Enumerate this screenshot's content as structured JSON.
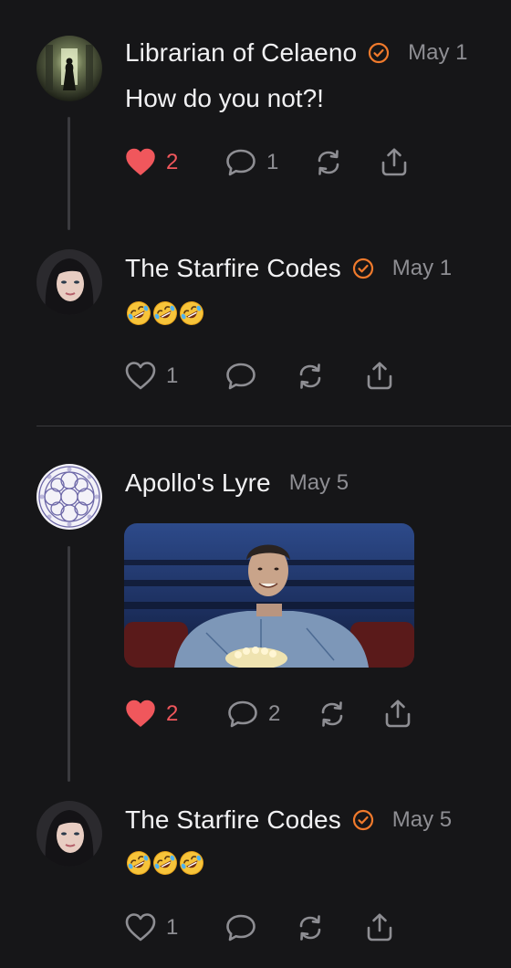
{
  "colors": {
    "background": "#161618",
    "verified": "#f07a2c",
    "liked": "#f0575c",
    "muted": "#8e8e93",
    "text": "#f1f1f3"
  },
  "posts": [
    {
      "author": "Librarian of Celaeno",
      "verified": true,
      "date": "May 1",
      "text": "How do you not?!",
      "liked": true,
      "like_count": "2",
      "reply_count": "1",
      "avatar_icon": "dark-hallway-avatar"
    },
    {
      "author": "The Starfire Codes",
      "verified": true,
      "date": "May 1",
      "emoji": [
        "rolling-on-floor-laughing-emoji",
        "rolling-on-floor-laughing-emoji",
        "rolling-on-floor-laughing-emoji"
      ],
      "liked": false,
      "like_count": "1",
      "reply_count": "",
      "avatar_icon": "woman-portrait-avatar"
    },
    {
      "author": "Apollo's Lyre",
      "verified": false,
      "date": "May 5",
      "media": "man-in-hospital-gown-eating-popcorn-gif",
      "liked": true,
      "like_count": "2",
      "reply_count": "2",
      "avatar_icon": "geometric-pattern-avatar"
    },
    {
      "author": "The Starfire Codes",
      "verified": true,
      "date": "May 5",
      "emoji": [
        "rolling-on-floor-laughing-emoji",
        "rolling-on-floor-laughing-emoji",
        "rolling-on-floor-laughing-emoji"
      ],
      "liked": false,
      "like_count": "1",
      "reply_count": "",
      "avatar_icon": "woman-portrait-avatar"
    }
  ],
  "icons": {
    "like": "heart-icon",
    "reply": "speech-bubble-icon",
    "repost": "repost-arrows-icon",
    "share": "share-upload-icon",
    "verified": "verified-check-badge-icon"
  }
}
